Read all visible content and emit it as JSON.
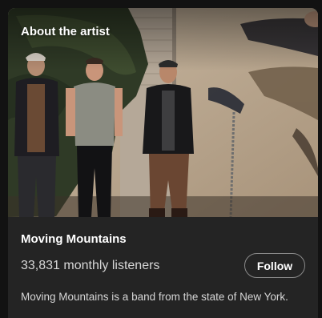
{
  "section": {
    "title": "About the artist"
  },
  "artist": {
    "name": "Moving Mountains",
    "monthly_listeners": "33,831 monthly listeners",
    "bio": "Moving Mountains is a band from the state of New York.",
    "image_description": "band-photo"
  },
  "actions": {
    "follow_label": "Follow"
  },
  "colors": {
    "background": "#121212",
    "card": "#242424",
    "text_primary": "#ffffff",
    "text_secondary": "#d6d6d6",
    "button_border": "#8a8a8a"
  }
}
